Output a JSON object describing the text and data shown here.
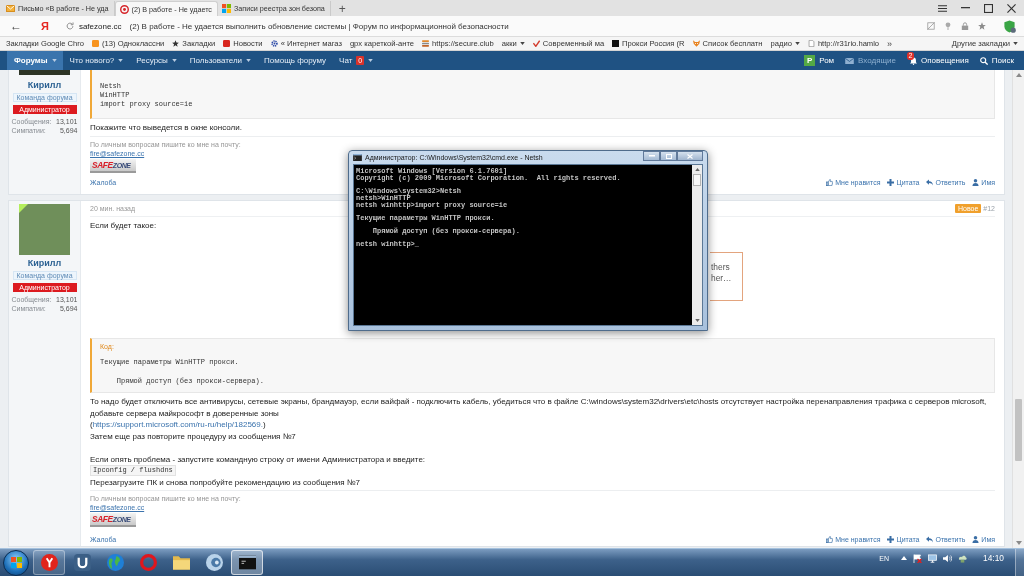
{
  "browser": {
    "tabs": [
      {
        "kind": "mail",
        "title": "Письмо «В работе - Не уда",
        "selected": false
      },
      {
        "kind": "forum",
        "title": "(2) В работе - Не удаетс",
        "selected": true
      },
      {
        "kind": "windows",
        "title": "Записи реестра зон безопа",
        "selected": false
      }
    ],
    "new_tab": "+",
    "back": "←",
    "logo": "Я",
    "domain": "safezone.cc",
    "page_title": "(2) В работе - Не удается выполнить обновление системы | Форум по информационной безопасности",
    "bookmarks": [
      {
        "kind": "plain",
        "label": "Закладки Google Chro",
        "caret": false
      },
      {
        "kind": "site",
        "color": "#f7931e",
        "label": "(13) Одноклассни",
        "caret": false
      },
      {
        "kind": "star",
        "label": "Закладки",
        "caret": false
      },
      {
        "kind": "site",
        "color": "#d8261f",
        "label": "Новости",
        "caret": false
      },
      {
        "kind": "gear",
        "label": "« Интернет магаз",
        "caret": false
      },
      {
        "kind": "plain",
        "label": "gpx кареткой-анте",
        "caret": false
      },
      {
        "kind": "stack",
        "label": "https://secure.club",
        "caret": false
      },
      {
        "kind": "plain",
        "label": "акки",
        "caret": true
      },
      {
        "kind": "check",
        "label": "Современный ма",
        "caret": false
      },
      {
        "kind": "square",
        "label": "Прокси Россия (R",
        "caret": false
      },
      {
        "kind": "fox",
        "label": "Список бесплатн",
        "caret": false
      },
      {
        "kind": "plain",
        "label": "радио",
        "caret": true
      },
      {
        "kind": "page",
        "label": "http://r31rio.hamlo",
        "caret": false
      }
    ],
    "more_bookmarks": "»",
    "other_bookmarks": {
      "label": "Другие закладки",
      "caret": true
    }
  },
  "forum_nav": {
    "items": [
      {
        "label": "Форумы",
        "selected": true,
        "caret": true
      },
      {
        "label": "Что нового?",
        "selected": false,
        "caret": true
      },
      {
        "label": "Ресурсы",
        "selected": false,
        "caret": true
      },
      {
        "label": "Пользователи",
        "selected": false,
        "caret": true
      },
      {
        "label": "Помощь форуму",
        "selected": false,
        "caret": false
      },
      {
        "label": "Чат",
        "selected": false,
        "caret": true,
        "badge": "0"
      }
    ]
  },
  "user_menu": {
    "avatar_letter": "Р",
    "name": "Ром",
    "inbox": {
      "label": "Входящие",
      "disabled": true
    },
    "alerts": {
      "label": "Оповещения",
      "badge": "2"
    },
    "search": "Поиск"
  },
  "posts": [
    {
      "author": {
        "name": "Кирилл",
        "title": "Команда форума",
        "role": "Администратор",
        "avatar": {
          "kind": "cropped"
        },
        "online": false,
        "stats": [
          {
            "label": "Сообщения:",
            "value": "13,101"
          },
          {
            "label": "Симпатии:",
            "value": "5,694"
          }
        ]
      },
      "body": [
        {
          "kind": "code",
          "groups": [
            [
              "Netsh",
              "WinHTTP",
              "import proxy source=ie"
            ]
          ]
        },
        {
          "kind": "text",
          "lines": [
            {
              "kind": "plain",
              "text": "Покажите что выведется в окне консоли."
            }
          ]
        }
      ],
      "signature": {
        "text": "По личным вопросам пишите ко мне на почту:",
        "email": "fire@safezone.cc",
        "logo": [
          "SAFE",
          "ZONE"
        ]
      },
      "footer": {
        "report": "Жалоба",
        "actions": [
          {
            "kind": "like",
            "label": "Мне нравится"
          },
          {
            "kind": "quote",
            "label": "Цитата"
          },
          {
            "kind": "reply",
            "label": "Ответить"
          },
          {
            "kind": "mention",
            "label": "Имя"
          }
        ]
      }
    },
    {
      "author": {
        "name": "Кирилл",
        "title": "Команда форума",
        "role": "Администратор",
        "avatar": {
          "kind": "photo"
        },
        "online": true,
        "stats": [
          {
            "label": "Сообщения:",
            "value": "13,101"
          },
          {
            "label": "Симпатии:",
            "value": "5,694"
          }
        ]
      },
      "header": {
        "time": "20 мин. назад",
        "badge": "Новое",
        "number": "#12"
      },
      "body": [
        {
          "kind": "text",
          "lines": [
            {
              "kind": "plain",
              "text": "Если будет такое:"
            }
          ]
        },
        {
          "kind": "image",
          "popup": [
            "thers",
            "her…"
          ]
        },
        {
          "kind": "code",
          "label": "Код:",
          "groups": [
            [
              "Текущие параметры WinHTTP прокси."
            ],
            [
              "    Прямой доступ (без прокси-сервера)."
            ]
          ]
        },
        {
          "kind": "text",
          "lines": [
            {
              "kind": "plain",
              "text": "То надо будет отключить все антивирусы, сетевые экраны, брандмауэр, если вайфай - подключить кабель, убедиться что в файле C:\\windows\\system32\\drivers\\etc\\hosts отсутствует настройка перенаправления трафика с серверов microsoft, добавьте сервера майкрософт в доверенные зоны"
            },
            {
              "kind": "link",
              "before": "(",
              "link": "https://support.microsoft.com/ru-ru/help/182569.",
              "after": ")"
            },
            {
              "kind": "plain",
              "text": "Затем еще раз повторите процедуру из сообщения №7"
            }
          ]
        },
        {
          "kind": "text",
          "lines": [
            {
              "kind": "plain",
              "text": "Если опять проблема - запустите командную строку от имени Администратора и введите:"
            },
            {
              "kind": "code",
              "text": "Ipconfig / flushdns"
            },
            {
              "kind": "plain",
              "text": "Перезагрузите ПК и снова попробуйте рекомендацию из сообщения №7"
            }
          ]
        }
      ],
      "signature": {
        "text": "По личным вопросам пишите ко мне на почту:",
        "email": "fire@safezone.cc",
        "logo": [
          "SAFE",
          "ZONE"
        ]
      },
      "footer": {
        "report": "Жалоба",
        "actions": [
          {
            "kind": "like",
            "label": "Мне нравится"
          },
          {
            "kind": "quote",
            "label": "Цитата"
          },
          {
            "kind": "reply",
            "label": "Ответить"
          },
          {
            "kind": "mention",
            "label": "Имя"
          }
        ]
      }
    }
  ],
  "console_window": {
    "title": "Администратор: C:\\Windows\\System32\\cmd.exe - Netsh",
    "groups": [
      [
        "Microsoft Windows [Version 6.1.7601]",
        "Copyright (c) 2009 Microsoft Corporation.  All rights reserved."
      ],
      [
        "C:\\Windows\\system32>Netsh",
        "netsh>WinHTTP",
        "netsh winhttp>import proxy source=ie"
      ],
      [
        "Текущие параметры WinHTTP прокси."
      ],
      [
        "    Прямой доступ (без прокси-сервера)."
      ],
      [
        "netsh winhttp>_"
      ]
    ]
  },
  "taskbar": {
    "apps": [
      {
        "kind": "browser",
        "running": true,
        "selected": false
      },
      {
        "kind": "torrent",
        "running": false,
        "selected": false
      },
      {
        "kind": "globe",
        "running": false,
        "selected": false
      },
      {
        "kind": "opera",
        "running": false,
        "selected": false
      },
      {
        "kind": "folder",
        "running": false,
        "selected": false
      },
      {
        "kind": "disc",
        "running": false,
        "selected": false
      },
      {
        "kind": "console",
        "running": true,
        "selected": true
      }
    ],
    "language": "EN",
    "time": "14:10"
  }
}
